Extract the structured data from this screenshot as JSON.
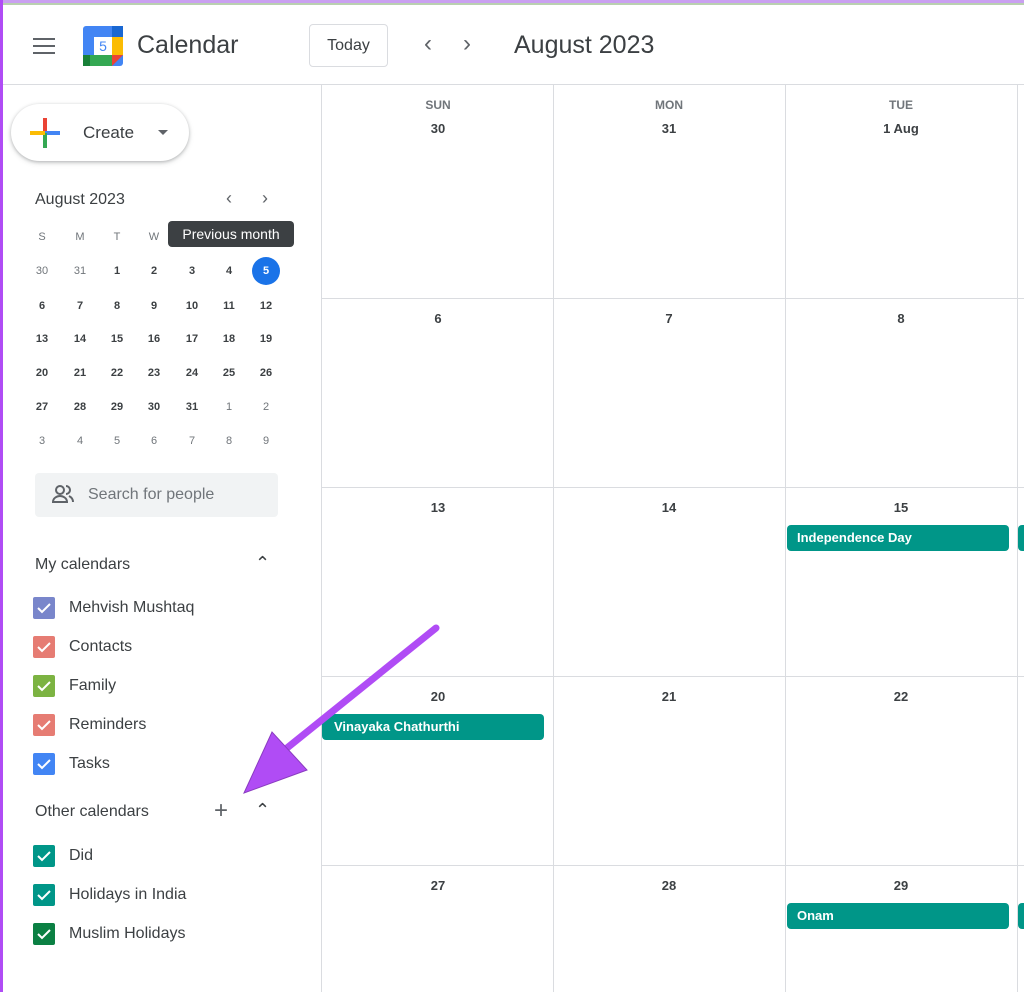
{
  "header": {
    "app_title": "Calendar",
    "logo_day": "5",
    "today_label": "Today",
    "month_title": "August 2023"
  },
  "create": {
    "label": "Create"
  },
  "mini_calendar": {
    "title": "August 2023",
    "tooltip": "Previous month",
    "weekdays": [
      "S",
      "M",
      "T",
      "W",
      "T",
      "F",
      "S"
    ],
    "weeks": [
      [
        {
          "d": "30",
          "other": true
        },
        {
          "d": "31",
          "other": true
        },
        {
          "d": "1"
        },
        {
          "d": "2"
        },
        {
          "d": "3"
        },
        {
          "d": "4"
        },
        {
          "d": "5",
          "today": true
        }
      ],
      [
        {
          "d": "6"
        },
        {
          "d": "7"
        },
        {
          "d": "8"
        },
        {
          "d": "9"
        },
        {
          "d": "10"
        },
        {
          "d": "11"
        },
        {
          "d": "12"
        }
      ],
      [
        {
          "d": "13"
        },
        {
          "d": "14"
        },
        {
          "d": "15"
        },
        {
          "d": "16"
        },
        {
          "d": "17"
        },
        {
          "d": "18"
        },
        {
          "d": "19"
        }
      ],
      [
        {
          "d": "20"
        },
        {
          "d": "21"
        },
        {
          "d": "22"
        },
        {
          "d": "23"
        },
        {
          "d": "24"
        },
        {
          "d": "25"
        },
        {
          "d": "26"
        }
      ],
      [
        {
          "d": "27"
        },
        {
          "d": "28"
        },
        {
          "d": "29"
        },
        {
          "d": "30"
        },
        {
          "d": "31"
        },
        {
          "d": "1",
          "other": true
        },
        {
          "d": "2",
          "other": true
        }
      ],
      [
        {
          "d": "3",
          "other": true
        },
        {
          "d": "4",
          "other": true
        },
        {
          "d": "5",
          "other": true
        },
        {
          "d": "6",
          "other": true
        },
        {
          "d": "7",
          "other": true
        },
        {
          "d": "8",
          "other": true
        },
        {
          "d": "9",
          "other": true
        }
      ]
    ]
  },
  "people_search": {
    "placeholder": "Search for people"
  },
  "my_calendars": {
    "title": "My calendars",
    "items": [
      {
        "label": "Mehvish Mushtaq",
        "color": "#7986cb"
      },
      {
        "label": "Contacts",
        "color": "#e67c73"
      },
      {
        "label": "Family",
        "color": "#7cb342"
      },
      {
        "label": "Reminders",
        "color": "#e67c73"
      },
      {
        "label": "Tasks",
        "color": "#4285f4"
      }
    ]
  },
  "other_calendars": {
    "title": "Other calendars",
    "items": [
      {
        "label": "Did",
        "color": "#009688"
      },
      {
        "label": "Holidays in India",
        "color": "#009688"
      },
      {
        "label": "Muslim Holidays",
        "color": "#0b8043"
      }
    ]
  },
  "grid": {
    "weekdays": [
      "SUN",
      "MON",
      "TUE"
    ],
    "weeks": [
      [
        "30",
        "31",
        "1 Aug"
      ],
      [
        "6",
        "7",
        "8"
      ],
      [
        "13",
        "14",
        "15"
      ],
      [
        "20",
        "21",
        "22"
      ],
      [
        "27",
        "28",
        "29"
      ]
    ],
    "event_color": "#009688",
    "events": [
      {
        "week": 2,
        "day": 2,
        "title": "Independence Day"
      },
      {
        "week": 3,
        "day": 0,
        "title": "Vinayaka Chathurthi"
      },
      {
        "week": 4,
        "day": 2,
        "title": "Onam"
      }
    ]
  },
  "annotation": {
    "arrow_color": "#b04cf5"
  }
}
